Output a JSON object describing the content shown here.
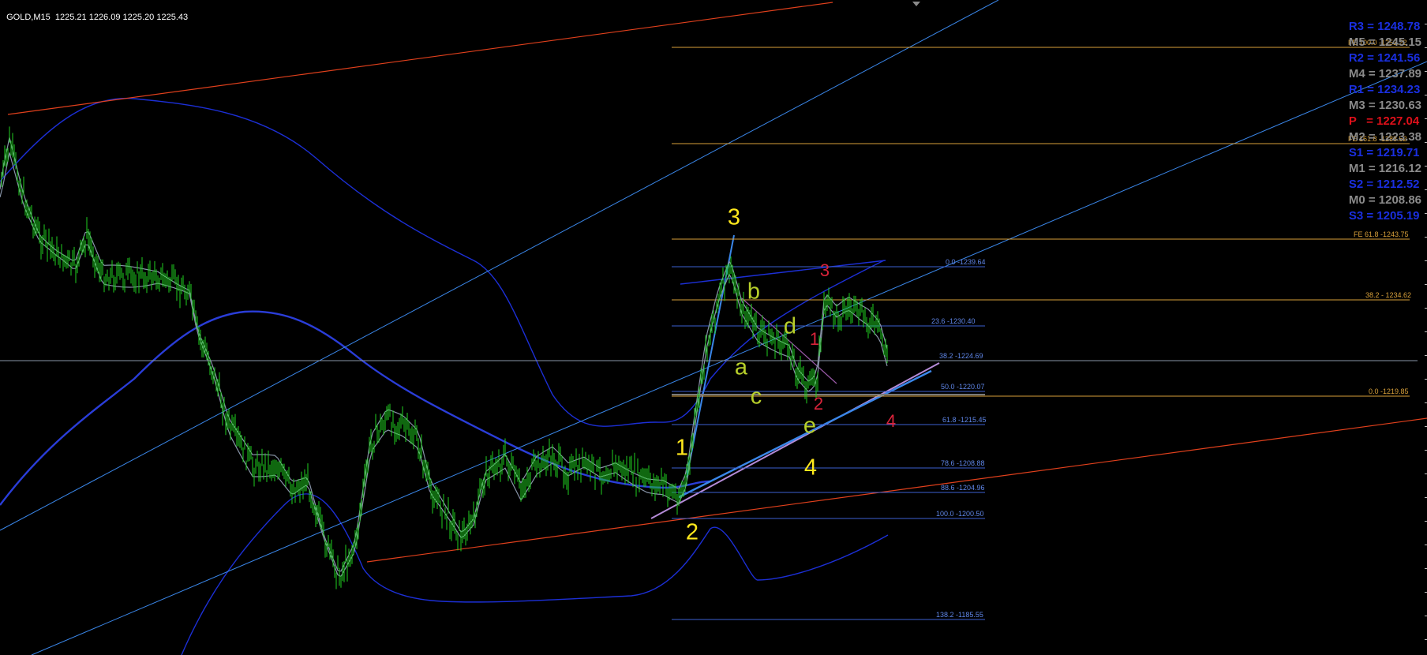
{
  "header": {
    "symbol": "GOLD,M15",
    "ohlc": "1225.21 1226.09 1225.20 1225.43"
  },
  "colors": {
    "background": "#000000",
    "candles": "#1fd11f",
    "channel_blue": "#1c2fd6",
    "trendline_blue": "#3a86e8",
    "trendline_red": "#e0401c",
    "fib_gold": "#d9a13a",
    "fib_blue": "#3b5fd0",
    "wave_yellow": "#ffe81c",
    "wave_olive": "#b7cf2a",
    "wave_red": "#d9233a"
  },
  "pivots": [
    {
      "label": "R3 = 1248.78",
      "color": "#1a2fe0"
    },
    {
      "label": "M5 = 1245.15",
      "color": "#8a8a8a"
    },
    {
      "label": "R2 = 1241.56",
      "color": "#1a2fe0"
    },
    {
      "label": "M4 = 1237.89",
      "color": "#8a8a8a"
    },
    {
      "label": "R1 = 1234.23",
      "color": "#1a2fe0"
    },
    {
      "label": "M3 = 1230.63",
      "color": "#8a8a8a"
    },
    {
      "label": "P   = 1227.04",
      "color": "#e0101a"
    },
    {
      "label": "M2 = 1223.38",
      "color": "#8a8a8a"
    },
    {
      "label": "S1 = 1219.71",
      "color": "#1a2fe0"
    },
    {
      "label": "M1 = 1216.12",
      "color": "#8a8a8a"
    },
    {
      "label": "S2 = 1212.52",
      "color": "#1a2fe0"
    },
    {
      "label": "M0 = 1208.86",
      "color": "#8a8a8a"
    },
    {
      "label": "S3 = 1205.19",
      "color": "#1a2fe0"
    }
  ],
  "fib_gold_labels": [
    {
      "text": "FE 100.0 -1253.22"
    },
    {
      "text": "FE 161.8 -1288.52"
    },
    {
      "text": "FE 61.8 -1243.75"
    },
    {
      "text": "38.2 - 1234.62"
    },
    {
      "text": "0.0 -1219.85"
    }
  ],
  "fib_blue_labels": [
    {
      "text": "0.0 -1239.64"
    },
    {
      "text": "23.6 -1230.40"
    },
    {
      "text": "38.2 -1224.69"
    },
    {
      "text": "50.0 -1220.07"
    },
    {
      "text": "61.8 -1215.45"
    },
    {
      "text": "78.6 -1208.88"
    },
    {
      "text": "88.6 -1204.96"
    },
    {
      "text": "100.0 -1200.50"
    },
    {
      "text": "138.2 -1185.55"
    }
  ],
  "waves": [
    {
      "text": "3",
      "color": "#ffe81c"
    },
    {
      "text": "1",
      "color": "#ffe81c"
    },
    {
      "text": "2",
      "color": "#ffe81c"
    },
    {
      "text": "4",
      "color": "#ffe81c"
    },
    {
      "text": "b",
      "color": "#b7cf2a"
    },
    {
      "text": "a",
      "color": "#b7cf2a"
    },
    {
      "text": "c",
      "color": "#b7cf2a"
    },
    {
      "text": "d",
      "color": "#b7cf2a"
    },
    {
      "text": "e",
      "color": "#b7cf2a"
    },
    {
      "text": "3",
      "color": "#d9233a"
    },
    {
      "text": "1",
      "color": "#d9233a"
    },
    {
      "text": "2",
      "color": "#d9233a"
    },
    {
      "text": "4",
      "color": "#d9233a"
    }
  ]
}
